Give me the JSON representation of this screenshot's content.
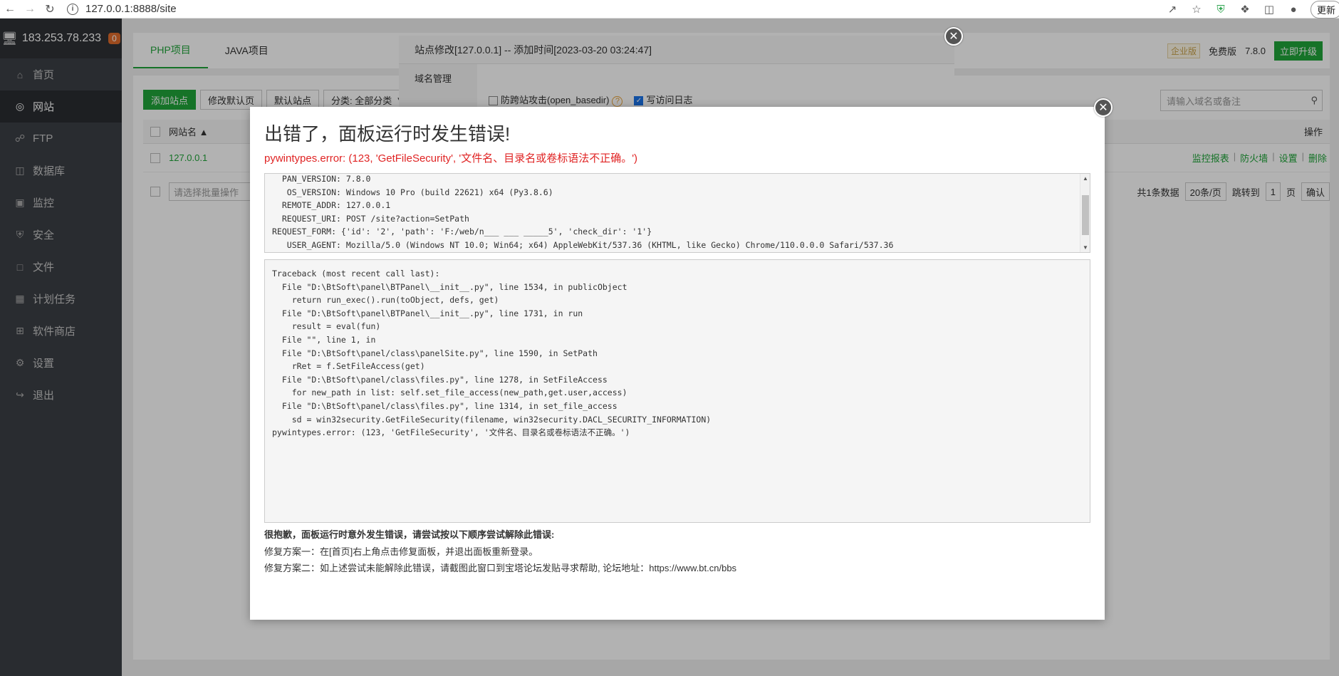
{
  "browser": {
    "url": "127.0.0.1:8888/site",
    "update_label": "更新"
  },
  "sidebar": {
    "server_ip": "183.253.78.233",
    "badge_count": "0",
    "items": [
      {
        "label": "首页",
        "icon": "home-icon"
      },
      {
        "label": "网站",
        "icon": "globe-icon"
      },
      {
        "label": "FTP",
        "icon": "ftp-icon"
      },
      {
        "label": "数据库",
        "icon": "database-icon"
      },
      {
        "label": "监控",
        "icon": "monitor-icon"
      },
      {
        "label": "安全",
        "icon": "shield-icon"
      },
      {
        "label": "文件",
        "icon": "folder-icon"
      },
      {
        "label": "计划任务",
        "icon": "calendar-icon"
      },
      {
        "label": "软件商店",
        "icon": "grid-icon"
      },
      {
        "label": "设置",
        "icon": "gear-icon"
      },
      {
        "label": "退出",
        "icon": "logout-icon"
      }
    ]
  },
  "tabs": {
    "php": "PHP项目",
    "java": "JAVA项目"
  },
  "topright": {
    "enterprise": "企业版",
    "free": "免费版",
    "version": "7.8.0",
    "upgrade": "立即升级"
  },
  "toolbar": {
    "add_site": "添加站点",
    "modify_default_page": "修改默认页",
    "default_site": "默认站点",
    "category": "分类: 全部分类"
  },
  "search": {
    "placeholder": "请输入域名或备注"
  },
  "table": {
    "col_site": "网站名 ▲",
    "col_actions": "操作",
    "row_site": "127.0.0.1",
    "row_actions": [
      "监控报表",
      "防火墙",
      "设置",
      "删除"
    ],
    "batch_placeholder": "请选择批量操作",
    "total": "共1条数据",
    "per_page": "20条/页",
    "jump_to": "跳转到",
    "page_num": "1",
    "page_unit": "页",
    "confirm": "确认"
  },
  "site_layer": {
    "title": "站点修改[127.0.0.1] -- 添加时间[2023-03-20 03:24:47]",
    "menu_domain": "域名管理",
    "opt_anti_xss": "防跨站攻击(open_basedir)",
    "opt_access_log": "写访问日志"
  },
  "error": {
    "title": "出错了，面板运行时发生错误!",
    "subtitle": "pywintypes.error: (123, 'GetFileSecurity', '文件名、目录名或卷标语法不正确。')",
    "env_lines": [
      "  PAN_VERSION: 7.8.0",
      "   OS_VERSION: Windows 10 Pro (build 22621) x64 (Py3.8.6)",
      "  REMOTE_ADDR: 127.0.0.1",
      "  REQUEST_URI: POST /site?action=SetPath",
      "REQUEST_FORM: {'id': '2', 'path': 'F:/web/n___ ___ _____5', 'check_dir': '1'}",
      "   USER_AGENT: Mozilla/5.0 (Windows NT 10.0; Win64; x64) AppleWebKit/537.36 (KHTML, like Gecko) Chrome/110.0.0.0 Safari/537.36"
    ],
    "traceback_lines": [
      "Traceback (most recent call last):",
      "  File \"D:\\BtSoft\\panel\\BTPanel\\__init__.py\", line 1534, in publicObject",
      "    return run_exec().run(toObject, defs, get)",
      "  File \"D:\\BtSoft\\panel\\BTPanel\\__init__.py\", line 1731, in run",
      "    result = eval(fun)",
      "  File \"\", line 1, in",
      "  File \"D:\\BtSoft\\panel/class\\panelSite.py\", line 1590, in SetPath",
      "    rRet = f.SetFileAccess(get)",
      "  File \"D:\\BtSoft\\panel/class\\files.py\", line 1278, in SetFileAccess",
      "    for new_path in list: self.set_file_access(new_path,get.user,access)",
      "  File \"D:\\BtSoft\\panel/class\\files.py\", line 1314, in set_file_access",
      "    sd = win32security.GetFileSecurity(filename, win32security.DACL_SECURITY_INFORMATION)",
      "pywintypes.error: (123, 'GetFileSecurity', '文件名、目录名或卷标语法不正确。')"
    ],
    "help_title": "很抱歉，面板运行时意外发生错误，请尝试按以下顺序尝试解除此错误:",
    "fix1": "修复方案一：在[首页]右上角点击修复面板，并退出面板重新登录。",
    "fix2": "修复方案二：如上述尝试未能解除此错误，请截图此窗口到宝塔论坛发贴寻求帮助, 论坛地址：https://www.bt.cn/bbs"
  },
  "colors": {
    "accent_green": "#20a53a",
    "error_red": "#e02424",
    "sidebar_bg": "#3b3f45"
  }
}
